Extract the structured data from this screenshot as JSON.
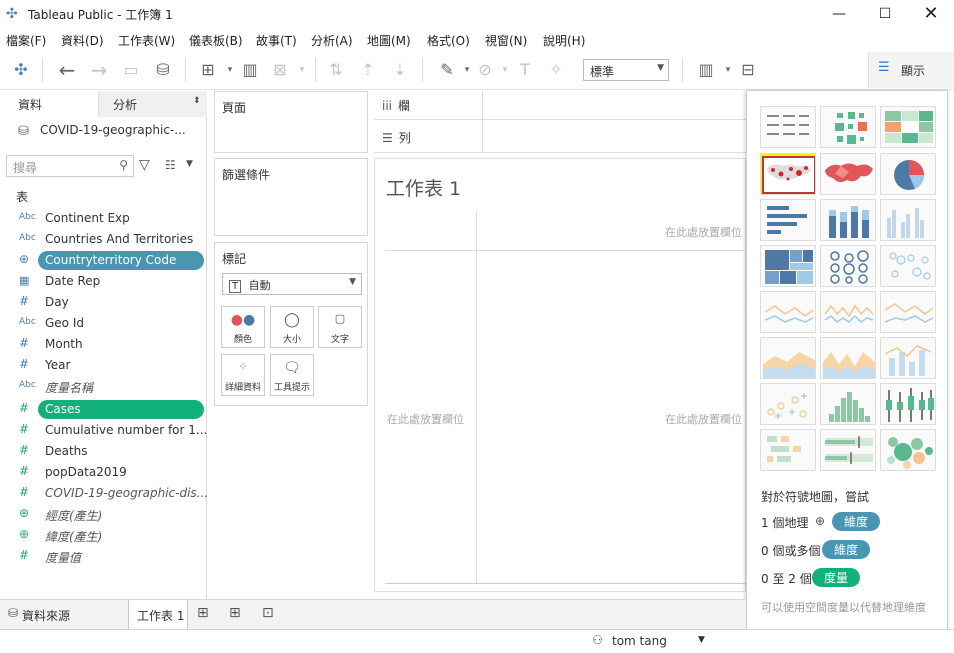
{
  "window": {
    "title": "Tableau Public - 工作簿 1"
  },
  "menu": [
    "檔案(F)",
    "資料(D)",
    "工作表(W)",
    "儀表板(B)",
    "故事(T)",
    "分析(A)",
    "地圖(M)",
    "格式(O)",
    "視窗(N)",
    "說明(H)"
  ],
  "toolbar": {
    "fit_value": "標準",
    "show_me_label": "顯示"
  },
  "data_pane": {
    "tab_data": "資料",
    "tab_analysis": "分析",
    "data_source": "COVID-19-geographic-...",
    "search_placeholder": "搜尋",
    "section_label": "表",
    "fields": [
      {
        "type": "Abc",
        "name": "Continent Exp"
      },
      {
        "type": "Abc",
        "name": "Countries And Territories"
      },
      {
        "type": "globe",
        "name": "Countryterritory Code"
      },
      {
        "type": "date",
        "name": "Date Rep"
      },
      {
        "type": "#",
        "name": "Day"
      },
      {
        "type": "Abc",
        "name": "Geo Id"
      },
      {
        "type": "#",
        "name": "Month"
      },
      {
        "type": "#",
        "name": "Year"
      },
      {
        "type": "Abc",
        "name": "度量名稱"
      },
      {
        "type": "#",
        "name": "Cases"
      },
      {
        "type": "#",
        "name": "Cumulative number for 1..."
      },
      {
        "type": "#",
        "name": "Deaths"
      },
      {
        "type": "#",
        "name": "popData2019"
      },
      {
        "type": "#",
        "name": "COVID-19-geographic-dis..."
      },
      {
        "type": "globe",
        "name": "經度(產生)"
      },
      {
        "type": "globe",
        "name": "緯度(產生)"
      },
      {
        "type": "#",
        "name": "度量值"
      }
    ]
  },
  "shelves": {
    "pages": "頁面",
    "filters": "篩選條件",
    "marks": "標記",
    "marks_type": "自動",
    "mark_buttons": [
      "顏色",
      "大小",
      "文字",
      "詳細資料",
      "工具提示"
    ],
    "columns": "欄",
    "rows": "列"
  },
  "canvas": {
    "sheet_title": "工作表 1",
    "drop_field": "在此處放置欄位",
    "drop_field_cut": "在此處放置欄位"
  },
  "show_me": {
    "hint_title": "對於符號地圖，嘗試",
    "req1_prefix": "1 個地理",
    "req1_badge": "維度",
    "req2_prefix": "0 個或多個",
    "req2_badge": "維度",
    "req3_prefix": "0 至 2 個",
    "req3_badge": "度量",
    "note": "可以使用空間度量以代替地理維度",
    "colors": {
      "dimension": "#4996b2",
      "measure": "#13b17a",
      "highlight": "#f5f500"
    }
  },
  "bottom": {
    "datasource_tab": "資料來源",
    "sheet_tab": "工作表 1"
  },
  "status": {
    "user": "tom tang"
  }
}
